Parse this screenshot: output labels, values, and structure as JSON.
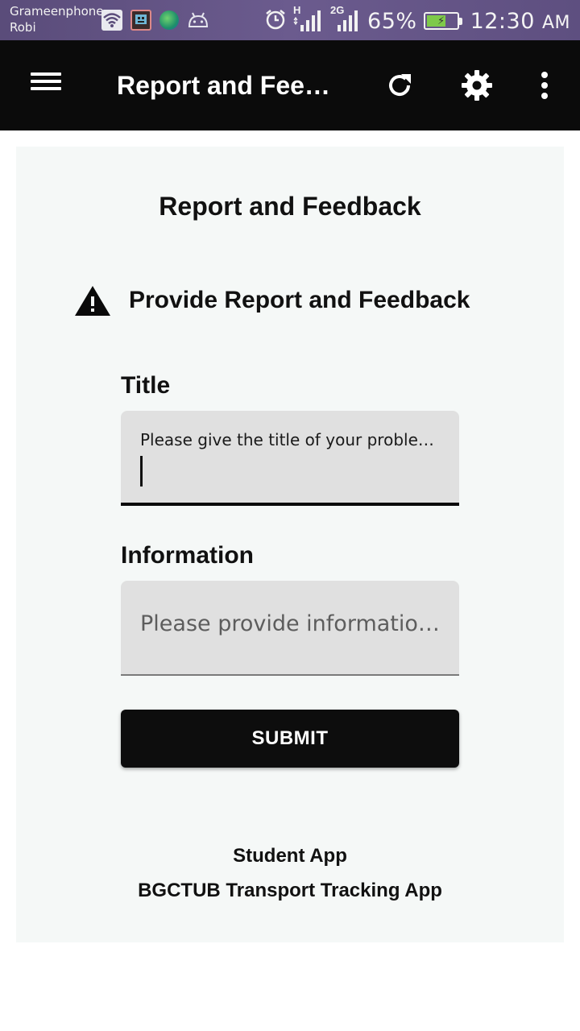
{
  "status_bar": {
    "carrier_1": "Grameenphone",
    "carrier_2": "Robi",
    "network_1_type": "H",
    "network_2_type": "2G",
    "battery_percent": "65%",
    "time": "12:30",
    "time_suffix": "AM",
    "icons": [
      "wifi-icon",
      "app-notification-icon",
      "globe-icon",
      "android-debug-icon",
      "alarm-icon",
      "signal-icon",
      "signal-icon",
      "battery-charging-icon"
    ]
  },
  "app_bar": {
    "title": "Report and Feedback",
    "icons": [
      "menu-icon",
      "refresh-icon",
      "settings-icon",
      "more-vert-icon"
    ]
  },
  "card": {
    "heading": "Report and Feedback",
    "warning_icon": "warning-icon",
    "subheading": "Provide Report and Feedback",
    "title_field": {
      "label": "Title",
      "floating_hint": "Please give the title of your problem or feedback",
      "value": ""
    },
    "information_field": {
      "label": "Information",
      "placeholder": "Please provide information about your problem or feedback",
      "value": ""
    },
    "submit_label": "SUBMIT",
    "footer_line_1": "Student App",
    "footer_line_2": "BGCTUB Transport Tracking App"
  },
  "colors": {
    "status_bar": "#5f4f82",
    "app_bar": "#0b0b0b",
    "card_background": "#f5f8f7",
    "input_background": "#e0e0e0",
    "button_background": "#0d0d0d",
    "battery_fill": "#7ec94a"
  }
}
